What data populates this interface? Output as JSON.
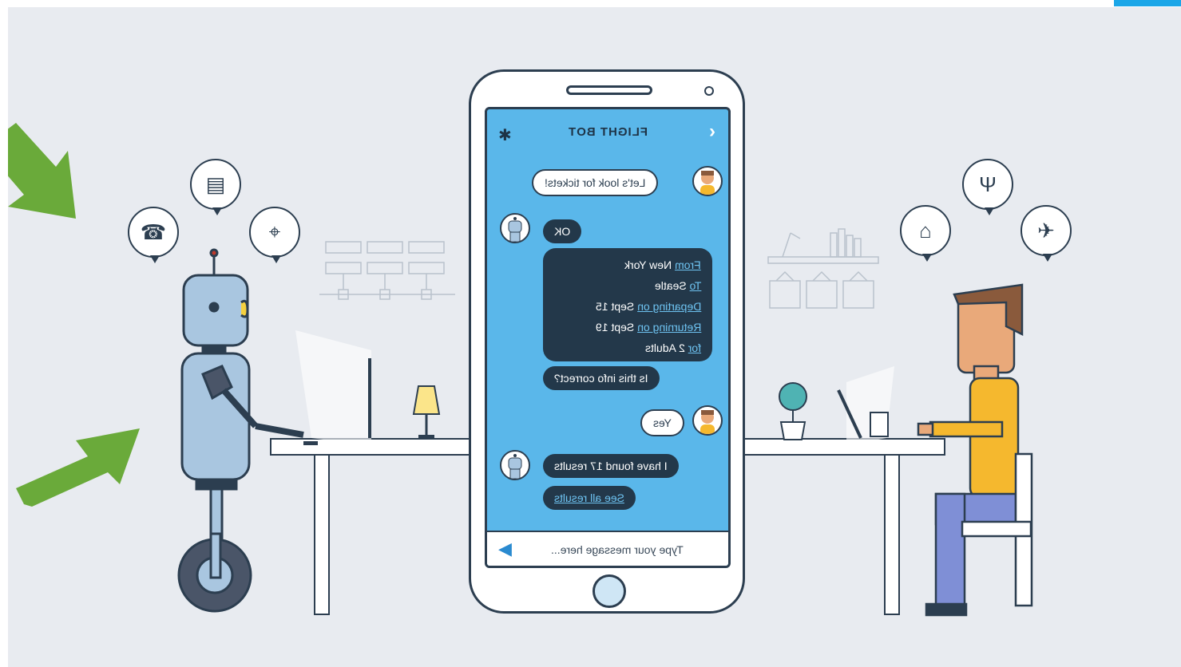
{
  "header": {
    "title": "FLIGHT BOT",
    "back_icon": "chevron-right-icon",
    "settings_icon": "gear-icon"
  },
  "messages": {
    "user1": "Let's look for tickets!",
    "bot1": "OK",
    "details": {
      "from_label": "From",
      "from_value": "New York",
      "to_label": "To",
      "to_value": "Seatle",
      "dep_label": "Departing on",
      "dep_value": "Sept 15",
      "ret_label": "Returning on",
      "ret_value": "Sept 19",
      "for_label": "for",
      "for_value": "2 Adults"
    },
    "bot2": "Is this info correct?",
    "user2": "Yes",
    "bot3": "I have found 17 results",
    "bot4": "See all results"
  },
  "input": {
    "placeholder": "Type your message here..."
  },
  "colors": {
    "screen": "#5ab7ea",
    "bot_bubble": "#23384a",
    "background": "#e8ebf0",
    "arrow": "#6aaa3a",
    "accent_tab": "#1aa6e8"
  }
}
